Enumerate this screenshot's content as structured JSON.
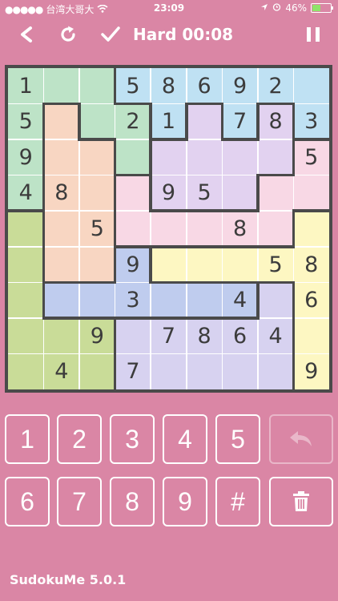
{
  "status_bar": {
    "carrier": "台湾大哥大",
    "time": "23:09",
    "battery_percent": "46%",
    "battery_level": 0.46
  },
  "toolbar": {
    "title": "Hard 00:08",
    "back_icon": "chevron-left-icon",
    "reset_icon": "refresh-icon",
    "check_icon": "checkmark-icon",
    "pause_icon": "pause-icon"
  },
  "board": {
    "regions": [
      [
        0,
        0,
        0,
        1,
        1,
        1,
        1,
        1,
        1
      ],
      [
        0,
        2,
        0,
        0,
        1,
        3,
        1,
        3,
        1
      ],
      [
        0,
        2,
        2,
        0,
        3,
        3,
        3,
        3,
        4
      ],
      [
        0,
        2,
        2,
        4,
        3,
        3,
        3,
        4,
        4
      ],
      [
        5,
        2,
        2,
        4,
        4,
        4,
        4,
        4,
        6
      ],
      [
        5,
        2,
        2,
        7,
        6,
        6,
        6,
        6,
        6
      ],
      [
        5,
        7,
        7,
        7,
        7,
        7,
        7,
        8,
        6
      ],
      [
        5,
        5,
        5,
        8,
        8,
        8,
        8,
        8,
        6
      ],
      [
        5,
        5,
        5,
        8,
        8,
        8,
        8,
        8,
        6
      ]
    ],
    "region_colors": [
      "#bde3c7",
      "#bfe1f3",
      "#f8d6c2",
      "#e2d2f0",
      "#f8d8e5",
      "#c9dc98",
      "#fdf7c2",
      "#bfccee",
      "#d7d2f0"
    ],
    "cells": [
      [
        "1",
        "",
        "",
        "5",
        "8",
        "6",
        "9",
        "2",
        ""
      ],
      [
        "5",
        "",
        "",
        "2",
        "1",
        "",
        "7",
        "8",
        "3"
      ],
      [
        "9",
        "",
        "",
        "",
        "",
        "",
        "",
        "",
        "5"
      ],
      [
        "4",
        "8",
        "",
        "",
        "9",
        "5",
        "",
        "",
        ""
      ],
      [
        "",
        "",
        "5",
        "",
        "",
        "",
        "8",
        "",
        ""
      ],
      [
        "",
        "",
        "",
        "9",
        "",
        "",
        "",
        "5",
        "8"
      ],
      [
        "",
        "",
        "",
        "3",
        "",
        "",
        "4",
        "",
        "6"
      ],
      [
        "",
        "",
        "9",
        "",
        "7",
        "8",
        "6",
        "4",
        ""
      ],
      [
        "",
        "4",
        "",
        "7",
        "",
        "",
        "",
        "",
        "9"
      ]
    ]
  },
  "keypad": {
    "row1": [
      "1",
      "2",
      "3",
      "4",
      "5"
    ],
    "row2": [
      "6",
      "7",
      "8",
      "9",
      "#"
    ],
    "undo_icon": "undo-icon",
    "delete_icon": "trash-icon"
  },
  "footer": {
    "app_name": "SudokuMe 5.0.1"
  },
  "colors": {
    "background": "#da86a5",
    "region_border": "#4a4a4a",
    "digit": "#3c3c3c"
  }
}
